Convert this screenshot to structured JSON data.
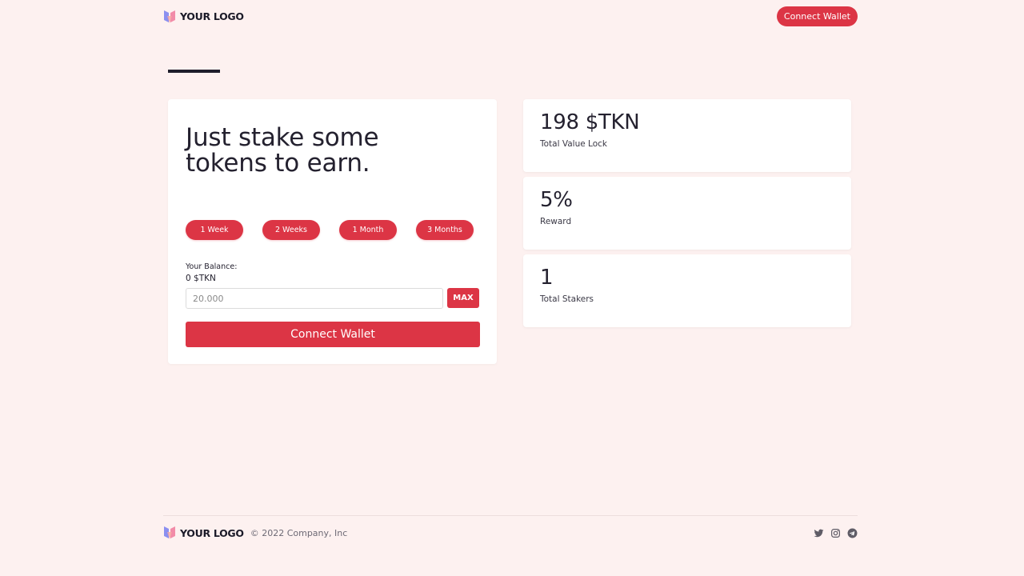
{
  "header": {
    "logo_text": "YOUR LOGO",
    "connect_label": "Connect Wallet"
  },
  "stake": {
    "headline": "Just stake some tokens to earn.",
    "periods": [
      "1 Week",
      "2 Weeks",
      "1 Month",
      "3 Months"
    ],
    "balance_label": "Your Balance:",
    "balance_value": "0 $TKN",
    "amount_placeholder": "20.000",
    "max_label": "MAX",
    "connect_label": "Connect Wallet"
  },
  "stats": [
    {
      "value": "198 $TKN",
      "label": "Total Value Lock"
    },
    {
      "value": "5%",
      "label": "Reward"
    },
    {
      "value": "1",
      "label": "Total Stakers"
    }
  ],
  "footer": {
    "logo_text": "YOUR LOGO",
    "copyright": "© 2022 Company, Inc",
    "socials": [
      "twitter-icon",
      "instagram-icon",
      "telegram-icon"
    ]
  },
  "colors": {
    "accent": "#dc3545",
    "background": "#fdf1f0",
    "text": "#1f1d2b"
  }
}
